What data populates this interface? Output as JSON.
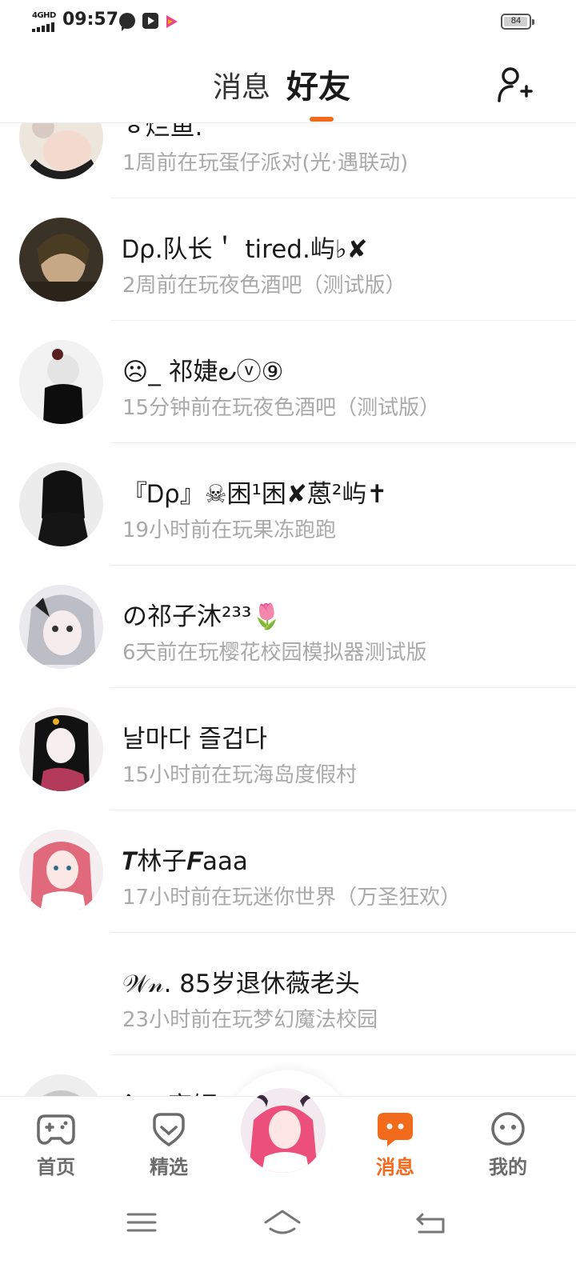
{
  "status_bar": {
    "network": "4GHD",
    "time": "09:57",
    "icons": [
      "chat-bubble-icon",
      "video-icon",
      "play-store-icon"
    ],
    "battery": "84",
    "battery_level": 0.84
  },
  "header": {
    "tabs": [
      {
        "label": "消息",
        "active": false
      },
      {
        "label": "好友",
        "active": true
      }
    ],
    "action_icon": "add-friend-icon",
    "accent_color": "#f26b1d"
  },
  "friends": [
    {
      "name": "ㅎ烂鱼.",
      "status": "1周前在玩蛋仔派对(光·遇联动)"
    },
    {
      "name": "Ꭰρ.队长＇ tired.屿♭✘",
      "status": "2周前在玩夜色酒吧（测试版）"
    },
    {
      "name": "☹_ 祁婕౿ⓥ⑨",
      "status": "15分钟前在玩夜色酒吧（测试版）"
    },
    {
      "name": "『Ꭰρ』☠困¹困✘蒽²屿✝",
      "status": "19小时前在玩果冻跑跑"
    },
    {
      "name": "の祁子沐²³³🌷",
      "status": "6天前在玩樱花校园模拟器测试版"
    },
    {
      "name": "날마다 즐겁다",
      "status": "15小时前在玩海岛度假村"
    },
    {
      "name": "𝑻林子𝑭aaa",
      "status": "17小时前在玩迷你世界（万圣狂欢）"
    },
    {
      "name": "𝒲𝓃. 85岁退休薇老头",
      "status": "23小时前在玩梦幻魔法校园"
    },
    {
      "name": "ˆ to家妍",
      "status": ""
    }
  ],
  "bottom_nav": [
    {
      "label": "首页",
      "icon": "gamepad-icon",
      "active": false
    },
    {
      "label": "精选",
      "icon": "heart-badge-icon",
      "active": false
    },
    {
      "label": "消息",
      "icon": "message-icon",
      "active": true
    },
    {
      "label": "我的",
      "icon": "smiley-icon",
      "active": false
    }
  ],
  "system_nav": [
    "menu-icon",
    "home-icon",
    "back-icon"
  ]
}
